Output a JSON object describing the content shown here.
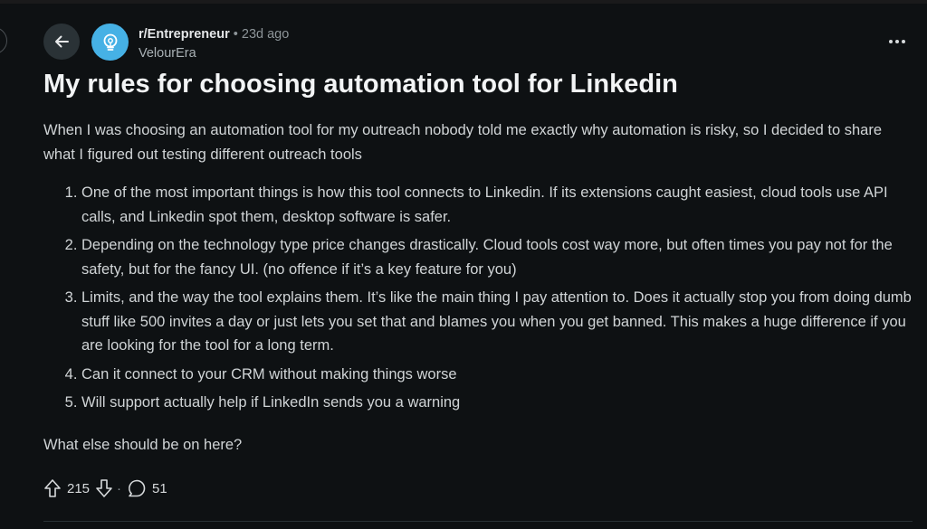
{
  "post": {
    "subreddit": "r/Entrepreneur",
    "separator": "•",
    "age": "23d ago",
    "author": "VelourEra",
    "title": "My rules for choosing automation tool for Linkedin",
    "intro": "When I was choosing an automation tool for my outreach nobody told me exactly why automation is risky, so I decided to share what I figured out testing different outreach tools",
    "items": [
      "One of the most important things is how this tool connects to Linkedin. If its extensions caught easiest, cloud tools use API calls, and Linkedin spot them, desktop software is safer.",
      "Depending on the technology type price changes drastically. Cloud tools cost way more, but often times you pay not for the safety, but for the fancy UI. (no offence if it’s a key feature for you)",
      "Limits, and the way the tool explains them. It’s like the main thing I pay attention to. Does it actually stop you from doing dumb stuff like 500 invites a day or just lets you set that and blames you when you get banned. This makes a huge difference if you are looking for the tool for a long term.",
      "Can it connect to your CRM without making things worse",
      "Will support actually help if LinkedIn sends you a warning"
    ],
    "closing": "What else should be on here?"
  },
  "actions": {
    "upvotes": "215",
    "separator": "·",
    "comments": "51"
  },
  "icons": {
    "back": "arrow-left-icon",
    "avatar": "lightbulb-icon",
    "more": "more-horizontal-icon",
    "upvote": "arrow-up-icon",
    "downvote": "arrow-down-icon",
    "comment": "speech-bubble-icon"
  },
  "colors": {
    "background": "#0e1113",
    "avatar": "#46b1e5",
    "back_button": "#2a3236"
  }
}
